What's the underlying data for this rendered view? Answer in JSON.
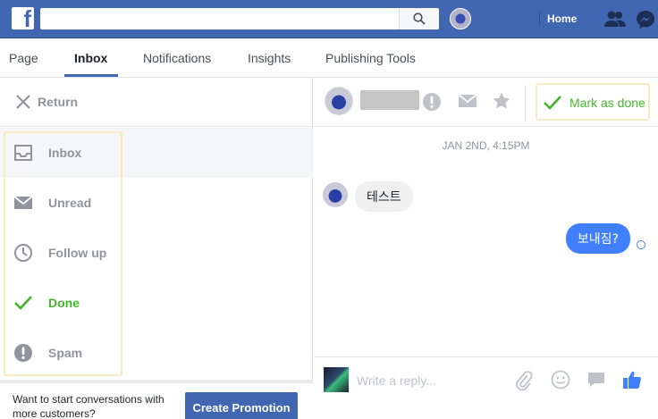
{
  "topbar": {
    "logo_letter": "f",
    "search_placeholder": "",
    "home_label": "Home",
    "icons": [
      "facebook-logo",
      "search-icon",
      "profile-avatar",
      "friends-icon",
      "messenger-icon"
    ]
  },
  "tabs": [
    {
      "label": "Page",
      "active": false
    },
    {
      "label": "Inbox",
      "active": true
    },
    {
      "label": "Notifications",
      "active": false
    },
    {
      "label": "Insights",
      "active": false
    },
    {
      "label": "Publishing Tools",
      "active": false
    }
  ],
  "sidebar": {
    "return_label": "Return",
    "items": [
      {
        "label": "Inbox",
        "icon": "inbox-tray-icon",
        "active": true
      },
      {
        "label": "Unread",
        "icon": "envelope-icon",
        "active": false
      },
      {
        "label": "Follow up",
        "icon": "clock-icon",
        "active": false
      },
      {
        "label": "Done",
        "icon": "check-icon",
        "active": false
      },
      {
        "label": "Spam",
        "icon": "alert-icon",
        "active": false
      }
    ],
    "promo_text": "Want to start conversations with more customers?",
    "promo_button": "Create Promotion"
  },
  "conversation": {
    "mark_done_label": "Mark as done",
    "timestamp": "JAN 2ND, 4:15PM",
    "messages": [
      {
        "direction": "incoming",
        "text": "테스트"
      },
      {
        "direction": "outgoing",
        "text": "보내짐?"
      }
    ],
    "reply_placeholder": "Write a reply..."
  },
  "colors": {
    "brand_blue": "#4267b2",
    "done_green": "#42b72a",
    "outgoing_bubble": "#4080ff",
    "highlight_border": "#f7eac0"
  }
}
